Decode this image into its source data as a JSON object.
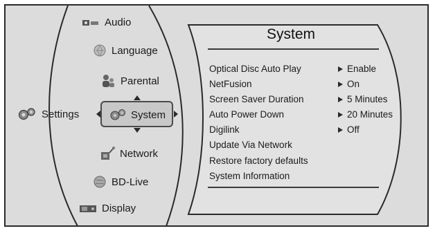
{
  "settings_label": "Settings",
  "menu": [
    {
      "label": "Audio",
      "icon": "speaker-icon"
    },
    {
      "label": "Language",
      "icon": "language-icon"
    },
    {
      "label": "Parental",
      "icon": "parental-icon"
    },
    {
      "label": "System",
      "icon": "gears-icon",
      "selected": true
    },
    {
      "label": "Network",
      "icon": "network-icon"
    },
    {
      "label": "BD-Live",
      "icon": "globe-icon"
    },
    {
      "label": "Display",
      "icon": "display-icon"
    }
  ],
  "panel": {
    "title": "System",
    "options": [
      {
        "label": "Optical Disc Auto Play",
        "value": "Enable"
      },
      {
        "label": "NetFusion",
        "value": "On"
      },
      {
        "label": "Screen Saver Duration",
        "value": "5 Minutes"
      },
      {
        "label": "Auto Power Down",
        "value": "20 Minutes"
      },
      {
        "label": "Digilink",
        "value": "Off"
      },
      {
        "label": "Update Via Network",
        "value": ""
      },
      {
        "label": "Restore factory defaults",
        "value": ""
      },
      {
        "label": "System Information",
        "value": ""
      }
    ]
  },
  "colors": {
    "background": "#dcdcdc",
    "selected": "#c8c8c8",
    "border": "#2a2a2a"
  }
}
